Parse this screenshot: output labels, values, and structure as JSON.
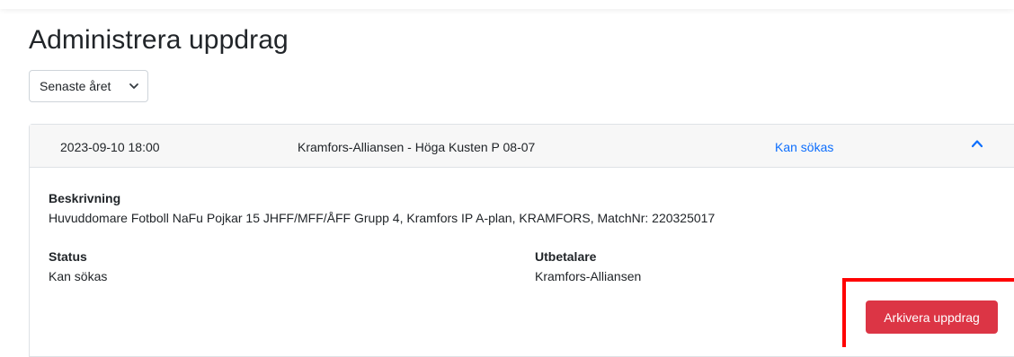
{
  "page": {
    "title": "Administrera uppdrag"
  },
  "filter": {
    "selected": "Senaste året",
    "chevron_icon": "chevron-down-icon"
  },
  "assignment": {
    "date": "2023-09-10 18:00",
    "match": "Kramfors-Alliansen - Höga Kusten P 08-07",
    "header_status": "Kan sökas",
    "collapse_icon": "chevron-up-icon",
    "status_color": "#0d6efd",
    "description_label": "Beskrivning",
    "description": "Huvuddomare Fotboll NaFu Pojkar 15 JHFF/MFF/ÅFF Grupp 4, Kramfors IP A-plan, KRAMFORS, MatchNr: 220325017",
    "status_label": "Status",
    "status_value": "Kan sökas",
    "payer_label": "Utbetalare",
    "payer_value": "Kramfors-Alliansen",
    "archive_button": "Arkivera uppdrag",
    "archive_color": "#dc3545"
  },
  "annotation": {
    "highlight_color": "#ff0000"
  }
}
